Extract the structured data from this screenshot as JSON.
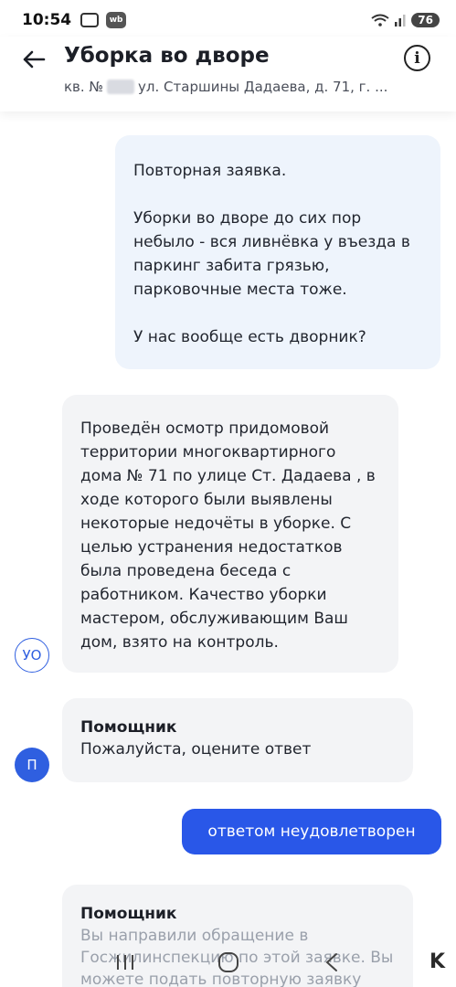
{
  "status_bar": {
    "time": "10:54",
    "battery": "76",
    "wb_badge": "wb"
  },
  "header": {
    "title": "Уборка во дворе",
    "address_prefix": "кв. №",
    "address_rest": "ул. Старшины Дадаева, д. 71, г. ...",
    "info_label": "i"
  },
  "messages": {
    "outgoing": {
      "line1": "Повторная заявка.",
      "line2": "Уборки во дворе до сих пор небыло - вся ливнёвка у въезда в паркинг забита грязью, парковочные места тоже.",
      "line3": "У нас вообще есть дворник?"
    },
    "incoming": {
      "avatar": "УО",
      "text": "Проведён осмотр придомовой территории многоквартирного дома № 71 по улице Ст. Дадаева , в ходе которого были выявлены некоторые недочёты в уборке. С целью устранения недостатков была проведена беседа с работником. Качество уборки мастером, обслуживающим Ваш дом, взято на контроль."
    },
    "assistant_1": {
      "avatar": "П",
      "name": "Помощник",
      "text": "Пожалуйста, оцените ответ"
    },
    "reply_button": "ответом неудовлетворен",
    "assistant_2": {
      "name": "Помощник",
      "text": "Вы направили обращение в Госжилинспекцию по этой заявке. Вы можете подать повторную заявку"
    }
  },
  "watermark": "K"
}
